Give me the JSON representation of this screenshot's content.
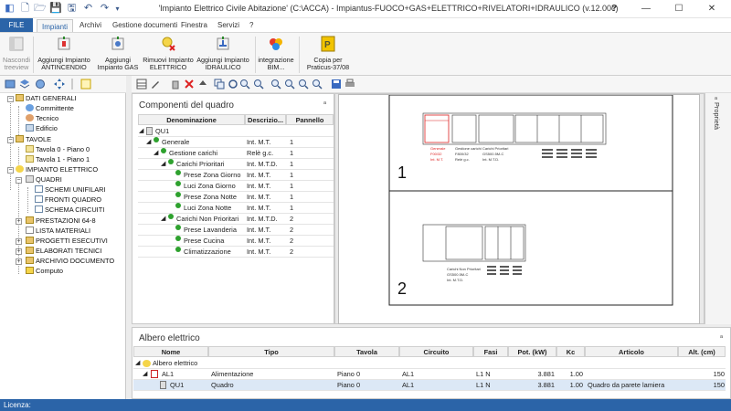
{
  "window": {
    "title": "'Impianto Elettrico Civile Abitazione' (C:\\ACCA) - Impiantus-FUOCO+GAS+ELETTRICO+RIVELATORI+IDRAULICO (v.12.00c)",
    "help": "?",
    "minimize": "—",
    "maximize": "☐",
    "close": "✕"
  },
  "tabs": [
    "FILE",
    "Impianti",
    "Archivi",
    "Gestione documenti",
    "Finestra",
    "Servizi",
    "?"
  ],
  "ribbon": {
    "nascondi": "Nascondi treeview",
    "aggiungi_antincendio": [
      "Aggiungi Impianto",
      "ANTINCENDIO"
    ],
    "aggiungi_gas": [
      "Aggiungi",
      "Impianto GAS"
    ],
    "rimuovi_elettrico": [
      "Rimuovi Impianto",
      "ELETTRICO"
    ],
    "aggiungi_idraulico": [
      "Aggiungi Impianto",
      "IDRAULICO"
    ],
    "integrazione_bim": [
      "integrazione",
      "BIM..."
    ],
    "copia_per": [
      "Copia per",
      "Praticus-37/08"
    ]
  },
  "tree": {
    "dati_generali": "DATI GENERALI",
    "committente": "Committente",
    "tecnico": "Tecnico",
    "edificio": "Edificio",
    "tavole": "TAVOLE",
    "tavola0": "Tavola 0 - Piano 0",
    "tavola1": "Tavola 1 - Piano 1",
    "impianto_elettrico": "IMPIANTO ELETTRICO",
    "quadri": "QUADRI",
    "schemi_unifilari": "SCHEMI UNIFILARI",
    "fronti_quadro": "FRONTI QUADRO",
    "schema_circuiti": "SCHEMA CIRCUITI",
    "prestazioni": "PRESTAZIONI 64-8",
    "lista_materiali": "LISTA MATERIALI",
    "progetti_esecutivi": "PROGETTI ESECUTIVI",
    "elaborati_tecnici": "ELABORATI TECNICI",
    "archivio_documento": "ARCHIVIO DOCUMENTO",
    "computo": "Computo"
  },
  "components": {
    "title": "Componenti del quadro",
    "pin": "ᵃ",
    "headers": [
      "Denominazione",
      "Descrizio...",
      "Pannello"
    ],
    "rows": [
      {
        "name": "QU1",
        "desc": "",
        "pan": ""
      },
      {
        "name": "Generale",
        "desc": "Int. M.T.",
        "pan": "1"
      },
      {
        "name": "Gestione carichi",
        "desc": "Relè g.c.",
        "pan": "1"
      },
      {
        "name": "Carichi Prioritari",
        "desc": "Int. M.T.D.",
        "pan": "1"
      },
      {
        "name": "Prese Zona Giorno",
        "desc": "Int. M.T.",
        "pan": "1"
      },
      {
        "name": "Luci Zona Giorno",
        "desc": "Int. M.T.",
        "pan": "1"
      },
      {
        "name": "Prese Zona Notte",
        "desc": "Int. M.T.",
        "pan": "1"
      },
      {
        "name": "Luci Zona Notte",
        "desc": "Int. M.T.",
        "pan": "1"
      },
      {
        "name": "Carichi Non Prioritari",
        "desc": "Int. M.T.D.",
        "pan": "2"
      },
      {
        "name": "Prese Lavanderia",
        "desc": "Int. M.T.",
        "pan": "2"
      },
      {
        "name": "Prese Cucina",
        "desc": "Int. M.T.",
        "pan": "2"
      },
      {
        "name": "Climatizzazione",
        "desc": "Int. M.T.",
        "pan": "2"
      }
    ]
  },
  "drawing": {
    "panel1": "1",
    "panel2": "2",
    "labels1": [
      "Generale",
      "Gestione carichi",
      "Carichi Prioritari"
    ],
    "sub1": [
      "F00/32",
      "F800/32",
      "GS500.5M-C"
    ],
    "sub1b": [
      "Int. M.T.",
      "Relè g.c.",
      "Int. M.T.D."
    ],
    "labels2": [
      "Carichi Non Prioritari"
    ],
    "sub2": [
      "GS500.5M-C"
    ],
    "sub2b": [
      "Int. M.T.D."
    ]
  },
  "properties": {
    "label": "Proprietà",
    "pin": "ᵃ"
  },
  "albero": {
    "title": "Albero elettrico",
    "pin": "ᵃ",
    "headers": [
      "Nome",
      "Tipo",
      "Tavola",
      "Circuito",
      "Fasi",
      "Pot. (kW)",
      "Kc",
      "Articolo",
      "Alt. (cm)"
    ],
    "root": "Albero elettrico",
    "rows": [
      {
        "nome": "AL1",
        "tipo": "Alimentazione",
        "tavola": "Piano 0",
        "circuito": "AL1",
        "fasi": "L1 N",
        "pot": "3.881",
        "kc": "1.00",
        "articolo": "",
        "alt": "150"
      },
      {
        "nome": "QU1",
        "tipo": "Quadro",
        "tavola": "Piano 0",
        "circuito": "AL1",
        "fasi": "L1 N",
        "pot": "3.881",
        "kc": "1.00",
        "articolo": "Quadro da parete lamiera",
        "alt": "150"
      }
    ]
  },
  "status": "Licenza:"
}
